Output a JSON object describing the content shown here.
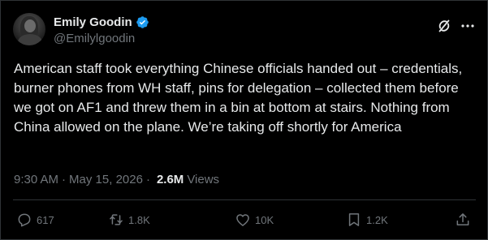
{
  "author": {
    "display_name": "Emily Goodin",
    "handle": "@Emilylgoodin",
    "verified": true,
    "verified_color": "#1d9bf0"
  },
  "header_icons": [
    "grok-icon",
    "more-icon"
  ],
  "tweet": {
    "text": "American staff took everything Chinese officials handed out – credentials, burner phones from WH staff, pins for delegation – collected them before we got on AF1 and threw them in a bin at bottom at stairs. Nothing from China allowed on the plane. We’re taking off shortly for America"
  },
  "meta": {
    "time": "9:30 AM",
    "separator": "·",
    "date": "May 15, 2026",
    "views_count": "2.6M",
    "views_label": "Views"
  },
  "actions": {
    "reply": {
      "icon": "reply-icon",
      "count": "617"
    },
    "repost": {
      "icon": "repost-icon",
      "count": "1.8K"
    },
    "like": {
      "icon": "heart-icon",
      "count": "10K"
    },
    "bookmark": {
      "icon": "bookmark-icon",
      "count": "1.2K"
    },
    "share": {
      "icon": "share-icon"
    }
  },
  "colors": {
    "background": "#000000",
    "text": "#e7e9ea",
    "muted": "#71767b",
    "border": "#2f3336"
  }
}
